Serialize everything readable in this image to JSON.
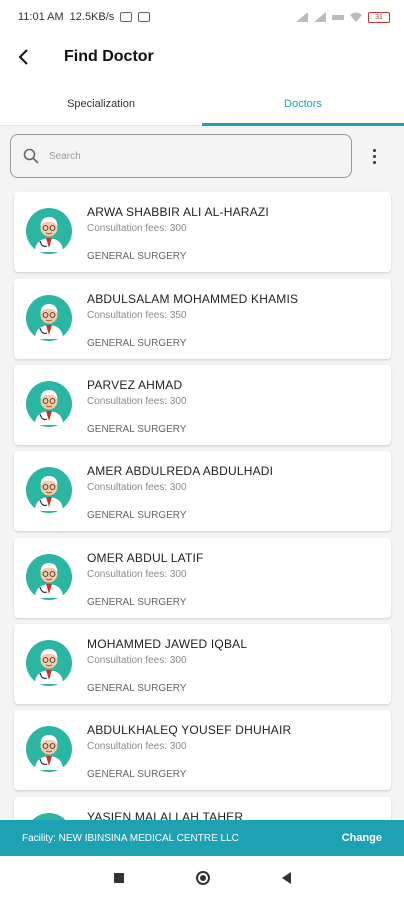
{
  "status_bar": {
    "time": "11:01 AM",
    "speed": "12.5KB/s",
    "battery": "31"
  },
  "header": {
    "title": "Find Doctor",
    "back_icon": "arrow-left-icon"
  },
  "tabs": [
    {
      "label": "Specialization",
      "active": false
    },
    {
      "label": "Doctors",
      "active": true
    }
  ],
  "search": {
    "placeholder": "Search",
    "value": ""
  },
  "doctors": [
    {
      "name": "ARWA SHABBIR ALI AL-HARAZI",
      "fee": "Consultation fees: 300",
      "specialization": "GENERAL SURGERY"
    },
    {
      "name": "ABDULSALAM MOHAMMED KHAMIS",
      "fee": "Consultation fees: 350",
      "specialization": "GENERAL SURGERY"
    },
    {
      "name": "PARVEZ AHMAD",
      "fee": "Consultation fees: 300",
      "specialization": "GENERAL SURGERY"
    },
    {
      "name": "AMER ABDULREDA ABDULHADI",
      "fee": "Consultation fees: 300",
      "specialization": "GENERAL SURGERY"
    },
    {
      "name": "OMER ABDUL LATIF",
      "fee": "Consultation fees: 300",
      "specialization": "GENERAL SURGERY"
    },
    {
      "name": "MOHAMMED JAWED IQBAL",
      "fee": "Consultation fees: 300",
      "specialization": "GENERAL SURGERY"
    },
    {
      "name": "ABDULKHALEQ YOUSEF DHUHAIR",
      "fee": "Consultation fees: 300",
      "specialization": "GENERAL SURGERY"
    },
    {
      "name": "YASIEN MALALLAH TAHER",
      "fee": "",
      "specialization": ""
    }
  ],
  "facility": {
    "text": "Facility: NEW IBINSINA MEDICAL CENTRE LLC",
    "change_label": "Change"
  },
  "colors": {
    "accent": "#1ea1b2",
    "avatar_bg": "#2bb5a3",
    "background": "#f4f4f4"
  }
}
